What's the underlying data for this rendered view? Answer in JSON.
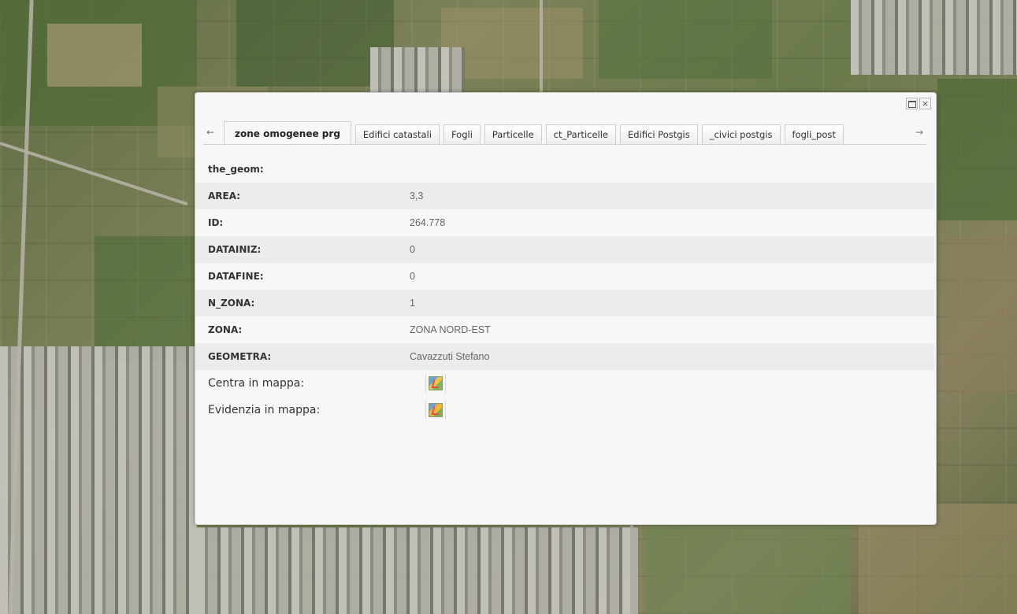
{
  "window": {
    "maximize_label": "",
    "close_label": "×"
  },
  "tabbar": {
    "left_arrow": "←",
    "right_arrow": "→",
    "tabs": [
      {
        "label": "zone omogenee prg"
      },
      {
        "label": "Edifici catastali"
      },
      {
        "label": "Fogli"
      },
      {
        "label": "Particelle"
      },
      {
        "label": "ct_Particelle"
      },
      {
        "label": "Edifici Postgis"
      },
      {
        "label": "_civici postgis"
      },
      {
        "label": "fogli_post"
      }
    ]
  },
  "attributes": [
    {
      "label": "the_geom:",
      "value": ""
    },
    {
      "label": "AREA:",
      "value": "3,3"
    },
    {
      "label": "ID:",
      "value": "264.778"
    },
    {
      "label": "DATAINIZ:",
      "value": "0"
    },
    {
      "label": "DATAFINE:",
      "value": "0"
    },
    {
      "label": "N_ZONA:",
      "value": "1"
    },
    {
      "label": "ZONA:",
      "value": "ZONA NORD-EST"
    },
    {
      "label": "GEOMETRA:",
      "value": "Cavazzuti Stefano"
    }
  ],
  "actions": [
    {
      "label": "Centra in mappa:",
      "icon": "map-center-icon"
    },
    {
      "label": "Evidenzia in mappa:",
      "icon": "map-highlight-icon"
    }
  ]
}
